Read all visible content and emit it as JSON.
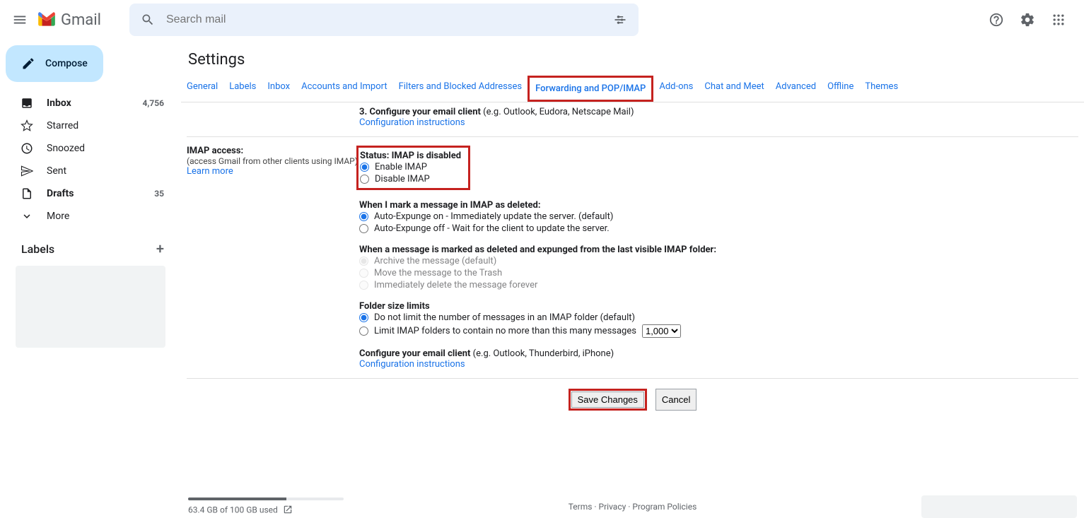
{
  "header": {
    "logo_text": "Gmail",
    "search_placeholder": "Search mail"
  },
  "compose_label": "Compose",
  "sidebar": {
    "items": [
      {
        "label": "Inbox",
        "count": "4,756",
        "bold": true,
        "icon": "inbox"
      },
      {
        "label": "Starred",
        "count": "",
        "bold": false,
        "icon": "star"
      },
      {
        "label": "Snoozed",
        "count": "",
        "bold": false,
        "icon": "clock"
      },
      {
        "label": "Sent",
        "count": "",
        "bold": false,
        "icon": "send"
      },
      {
        "label": "Drafts",
        "count": "35",
        "bold": true,
        "icon": "file"
      },
      {
        "label": "More",
        "count": "",
        "bold": false,
        "icon": "expand"
      }
    ],
    "labels_header": "Labels"
  },
  "settings": {
    "title": "Settings",
    "tabs": [
      "General",
      "Labels",
      "Inbox",
      "Accounts and Import",
      "Filters and Blocked Addresses",
      "Forwarding and POP/IMAP",
      "Add-ons",
      "Chat and Meet",
      "Advanced",
      "Offline",
      "Themes"
    ],
    "active_tab_index": 5,
    "pop_step": "3. Configure your email client",
    "pop_step_hint": "(e.g. Outlook, Eudora, Netscape Mail)",
    "config_link": "Configuration instructions",
    "imap": {
      "title": "IMAP access:",
      "sub": "(access Gmail from other clients using IMAP)",
      "learn": "Learn more",
      "status": "Status: IMAP is disabled",
      "opt_enable": "Enable IMAP",
      "opt_disable": "Disable IMAP",
      "deleted_header": "When I mark a message in IMAP as deleted:",
      "auto_on": "Auto-Expunge on - Immediately update the server. (default)",
      "auto_off": "Auto-Expunge off - Wait for the client to update the server.",
      "expunge_header": "When a message is marked as deleted and expunged from the last visible IMAP folder:",
      "exp_archive": "Archive the message (default)",
      "exp_trash": "Move the message to the Trash",
      "exp_delete": "Immediately delete the message forever",
      "folder_header": "Folder size limits",
      "folder_no_limit": "Do not limit the number of messages in an IMAP folder (default)",
      "folder_limit": "Limit IMAP folders to contain no more than this many messages",
      "folder_limit_value": "1,000",
      "config_client": "Configure your email client",
      "config_client_hint": "(e.g. Outlook, Thunderbird, iPhone)"
    },
    "save_button": "Save Changes",
    "cancel_button": "Cancel"
  },
  "footer": {
    "storage": "63.4 GB of 100 GB used",
    "terms": "Terms",
    "privacy": "Privacy",
    "policies": "Program Policies"
  }
}
